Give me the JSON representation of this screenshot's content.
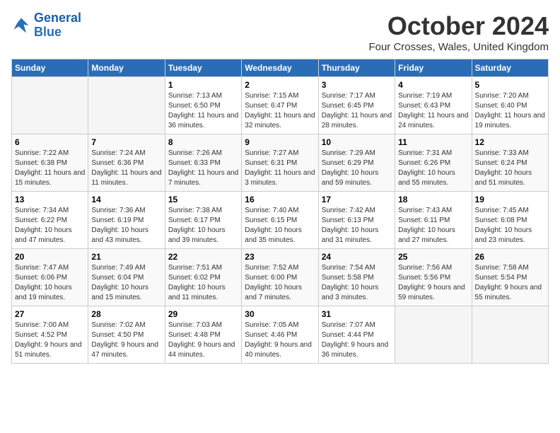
{
  "logo": {
    "line1": "General",
    "line2": "Blue"
  },
  "title": "October 2024",
  "location": "Four Crosses, Wales, United Kingdom",
  "days_header": [
    "Sunday",
    "Monday",
    "Tuesday",
    "Wednesday",
    "Thursday",
    "Friday",
    "Saturday"
  ],
  "weeks": [
    [
      {
        "day": "",
        "info": ""
      },
      {
        "day": "",
        "info": ""
      },
      {
        "day": "1",
        "info": "Sunrise: 7:13 AM\nSunset: 6:50 PM\nDaylight: 11 hours and 36 minutes."
      },
      {
        "day": "2",
        "info": "Sunrise: 7:15 AM\nSunset: 6:47 PM\nDaylight: 11 hours and 32 minutes."
      },
      {
        "day": "3",
        "info": "Sunrise: 7:17 AM\nSunset: 6:45 PM\nDaylight: 11 hours and 28 minutes."
      },
      {
        "day": "4",
        "info": "Sunrise: 7:19 AM\nSunset: 6:43 PM\nDaylight: 11 hours and 24 minutes."
      },
      {
        "day": "5",
        "info": "Sunrise: 7:20 AM\nSunset: 6:40 PM\nDaylight: 11 hours and 19 minutes."
      }
    ],
    [
      {
        "day": "6",
        "info": "Sunrise: 7:22 AM\nSunset: 6:38 PM\nDaylight: 11 hours and 15 minutes."
      },
      {
        "day": "7",
        "info": "Sunrise: 7:24 AM\nSunset: 6:36 PM\nDaylight: 11 hours and 11 minutes."
      },
      {
        "day": "8",
        "info": "Sunrise: 7:26 AM\nSunset: 6:33 PM\nDaylight: 11 hours and 7 minutes."
      },
      {
        "day": "9",
        "info": "Sunrise: 7:27 AM\nSunset: 6:31 PM\nDaylight: 11 hours and 3 minutes."
      },
      {
        "day": "10",
        "info": "Sunrise: 7:29 AM\nSunset: 6:29 PM\nDaylight: 10 hours and 59 minutes."
      },
      {
        "day": "11",
        "info": "Sunrise: 7:31 AM\nSunset: 6:26 PM\nDaylight: 10 hours and 55 minutes."
      },
      {
        "day": "12",
        "info": "Sunrise: 7:33 AM\nSunset: 6:24 PM\nDaylight: 10 hours and 51 minutes."
      }
    ],
    [
      {
        "day": "13",
        "info": "Sunrise: 7:34 AM\nSunset: 6:22 PM\nDaylight: 10 hours and 47 minutes."
      },
      {
        "day": "14",
        "info": "Sunrise: 7:36 AM\nSunset: 6:19 PM\nDaylight: 10 hours and 43 minutes."
      },
      {
        "day": "15",
        "info": "Sunrise: 7:38 AM\nSunset: 6:17 PM\nDaylight: 10 hours and 39 minutes."
      },
      {
        "day": "16",
        "info": "Sunrise: 7:40 AM\nSunset: 6:15 PM\nDaylight: 10 hours and 35 minutes."
      },
      {
        "day": "17",
        "info": "Sunrise: 7:42 AM\nSunset: 6:13 PM\nDaylight: 10 hours and 31 minutes."
      },
      {
        "day": "18",
        "info": "Sunrise: 7:43 AM\nSunset: 6:11 PM\nDaylight: 10 hours and 27 minutes."
      },
      {
        "day": "19",
        "info": "Sunrise: 7:45 AM\nSunset: 6:08 PM\nDaylight: 10 hours and 23 minutes."
      }
    ],
    [
      {
        "day": "20",
        "info": "Sunrise: 7:47 AM\nSunset: 6:06 PM\nDaylight: 10 hours and 19 minutes."
      },
      {
        "day": "21",
        "info": "Sunrise: 7:49 AM\nSunset: 6:04 PM\nDaylight: 10 hours and 15 minutes."
      },
      {
        "day": "22",
        "info": "Sunrise: 7:51 AM\nSunset: 6:02 PM\nDaylight: 10 hours and 11 minutes."
      },
      {
        "day": "23",
        "info": "Sunrise: 7:52 AM\nSunset: 6:00 PM\nDaylight: 10 hours and 7 minutes."
      },
      {
        "day": "24",
        "info": "Sunrise: 7:54 AM\nSunset: 5:58 PM\nDaylight: 10 hours and 3 minutes."
      },
      {
        "day": "25",
        "info": "Sunrise: 7:56 AM\nSunset: 5:56 PM\nDaylight: 9 hours and 59 minutes."
      },
      {
        "day": "26",
        "info": "Sunrise: 7:58 AM\nSunset: 5:54 PM\nDaylight: 9 hours and 55 minutes."
      }
    ],
    [
      {
        "day": "27",
        "info": "Sunrise: 7:00 AM\nSunset: 4:52 PM\nDaylight: 9 hours and 51 minutes."
      },
      {
        "day": "28",
        "info": "Sunrise: 7:02 AM\nSunset: 4:50 PM\nDaylight: 9 hours and 47 minutes."
      },
      {
        "day": "29",
        "info": "Sunrise: 7:03 AM\nSunset: 4:48 PM\nDaylight: 9 hours and 44 minutes."
      },
      {
        "day": "30",
        "info": "Sunrise: 7:05 AM\nSunset: 4:46 PM\nDaylight: 9 hours and 40 minutes."
      },
      {
        "day": "31",
        "info": "Sunrise: 7:07 AM\nSunset: 4:44 PM\nDaylight: 9 hours and 36 minutes."
      },
      {
        "day": "",
        "info": ""
      },
      {
        "day": "",
        "info": ""
      }
    ]
  ]
}
